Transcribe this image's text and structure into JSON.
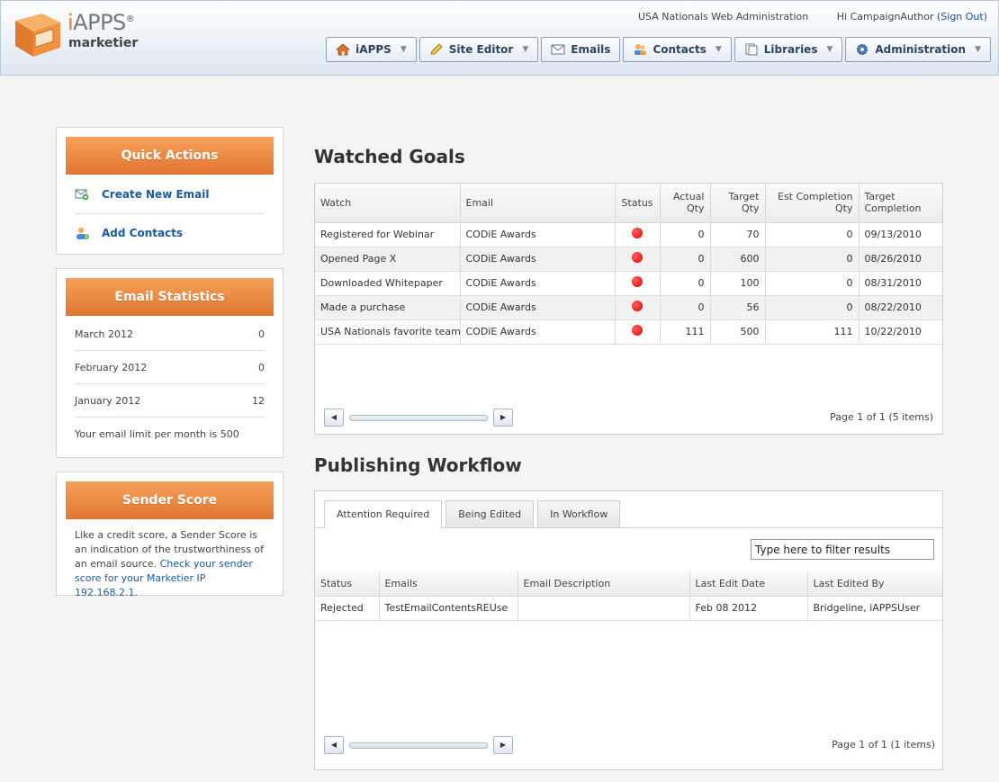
{
  "header": {
    "brand_main": "APPS",
    "brand_i": "i",
    "brand_reg": "®",
    "brand_sub": "marketier",
    "site_name": "USA Nationals Web Administration",
    "greeting": "Hi CampaignAuthor",
    "sign_out": "(Sign Out)"
  },
  "nav": [
    {
      "label": "iAPPS",
      "icon": "home-icon",
      "dropdown": true
    },
    {
      "label": "Site Editor",
      "icon": "pencil-icon",
      "dropdown": true
    },
    {
      "label": "Emails",
      "icon": "envelope-icon",
      "dropdown": false
    },
    {
      "label": "Contacts",
      "icon": "contacts-icon",
      "dropdown": true
    },
    {
      "label": "Libraries",
      "icon": "library-icon",
      "dropdown": true
    },
    {
      "label": "Administration",
      "icon": "gear-icon",
      "dropdown": true
    }
  ],
  "quick_actions": {
    "title": "Quick Actions",
    "items": [
      {
        "label": "Create New Email",
        "icon": "new-email-icon"
      },
      {
        "label": "Add Contacts",
        "icon": "add-contact-icon"
      }
    ]
  },
  "email_statistics": {
    "title": "Email Statistics",
    "rows": [
      {
        "month": "March 2012",
        "count": "0"
      },
      {
        "month": "February 2012",
        "count": "0"
      },
      {
        "month": "January 2012",
        "count": "12"
      }
    ],
    "note": "Your email limit per month is 500"
  },
  "sender_score": {
    "title": "Sender Score",
    "text": "Like a credit score, a Sender Score is an indication of the trustworthiness of an email source.",
    "link": "Check your sender score for your Marketier IP 192.168.2.1."
  },
  "watched_goals": {
    "title": "Watched Goals",
    "columns": {
      "watch": "Watch",
      "email": "Email",
      "status": "Status",
      "actual_1": "Actual",
      "actual_2": "Qty",
      "target_1": "Target",
      "target_2": "Qty",
      "est_1": "Est Completion",
      "est_2": "Qty",
      "tc_1": "Target",
      "tc_2": "Completion"
    },
    "rows": [
      {
        "watch": "Registered for Webinar",
        "email": "CODiE Awards",
        "actual": "0",
        "target": "70",
        "est": "0",
        "date": "09/13/2010"
      },
      {
        "watch": "Opened Page X",
        "email": "CODiE Awards",
        "actual": "0",
        "target": "600",
        "est": "0",
        "date": "08/26/2010"
      },
      {
        "watch": "Downloaded Whitepaper",
        "email": "CODiE Awards",
        "actual": "0",
        "target": "100",
        "est": "0",
        "date": "08/31/2010"
      },
      {
        "watch": "Made a purchase",
        "email": "CODiE Awards",
        "actual": "0",
        "target": "56",
        "est": "0",
        "date": "08/22/2010"
      },
      {
        "watch": "USA Nationals favorite team",
        "email": "CODiE Awards",
        "actual": "111",
        "target": "500",
        "est": "111",
        "date": "10/22/2010"
      }
    ],
    "status_color": "#e00000",
    "page_info": "Page 1 of 1 (5 items)"
  },
  "publishing_workflow": {
    "title": "Publishing Workflow",
    "tabs": [
      "Attention Required",
      "Being Edited",
      "In Workflow"
    ],
    "filter_value": "Type here to filter results",
    "columns": [
      "Status",
      "Emails",
      "Email Description",
      "Last Edit Date",
      "Last Edited By"
    ],
    "rows": [
      {
        "status": "Rejected",
        "email": "TestEmailContentsREUse",
        "description": "",
        "date": "Feb 08 2012",
        "by": "Bridgeline, iAPPSUser"
      }
    ],
    "page_info": "Page 1 of 1 (1 items)"
  },
  "colors": {
    "accent_orange": "#e8822e",
    "link_blue": "#1a5a9e",
    "header_bg": "#dde7f1"
  }
}
